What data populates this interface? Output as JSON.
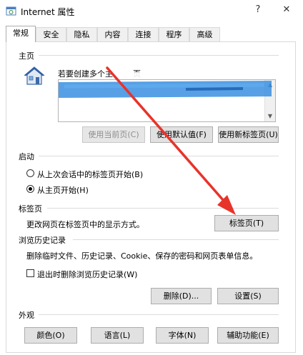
{
  "window": {
    "title": "Internet 属性",
    "help_glyph": "?",
    "close_glyph": "✕"
  },
  "tabs": [
    {
      "label": "常规",
      "active": true
    },
    {
      "label": "安全"
    },
    {
      "label": "隐私"
    },
    {
      "label": "内容"
    },
    {
      "label": "连接"
    },
    {
      "label": "程序"
    },
    {
      "label": "高级"
    }
  ],
  "home": {
    "section": "主页",
    "hint": "若要创建多个主",
    "hint_tail": "页",
    "buttons": {
      "use_current": "使用当前页(C)",
      "use_default": "使用默认值(F)",
      "use_new_tab": "使用新标签页(U)"
    }
  },
  "startup": {
    "section": "启动",
    "option_last_session": "从上次会话中的标签页开始(B)",
    "option_home": "从主页开始(H)"
  },
  "tabs_section": {
    "section": "标签页",
    "description": "更改网页在标签页中的显示方式。",
    "button": "标签页(T)"
  },
  "history": {
    "section": "浏览历史记录",
    "description": "删除临时文件、历史记录、Cookie、保存的密码和网页表单信息。",
    "checkbox": "退出时删除浏览历史记录(W)",
    "delete_button": "删除(D)...",
    "settings_button": "设置(S)"
  },
  "appearance": {
    "section": "外观",
    "colors": "颜色(O)",
    "languages": "语言(L)",
    "fonts": "字体(N)",
    "accessibility": "辅助功能(E)"
  },
  "colors": {
    "arrow": "#e8332a",
    "redaction": "#3a8fe0"
  }
}
